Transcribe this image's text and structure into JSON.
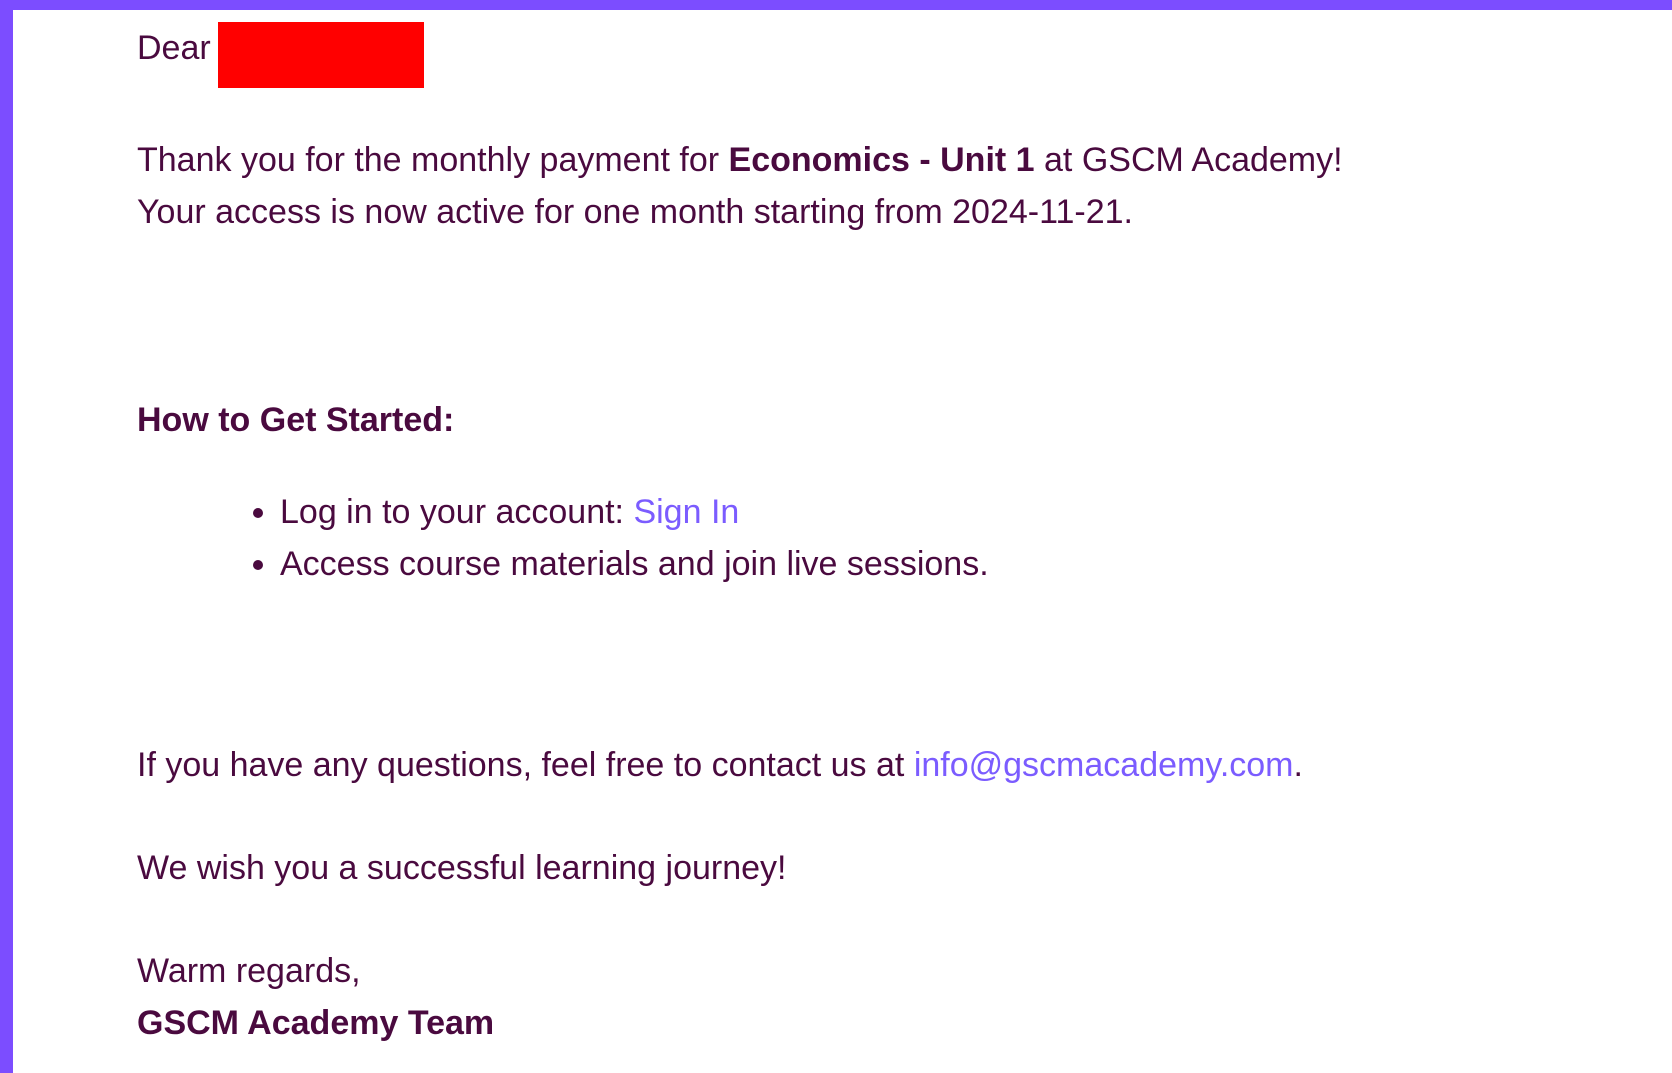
{
  "email": {
    "greeting": {
      "prefix": "Dear",
      "redaction_color": "#ff0000"
    },
    "intro": {
      "line1_before": "Thank you for the monthly payment for ",
      "course": "Economics - Unit 1",
      "line1_after": " at GSCM Academy!",
      "line2": "Your access is now active for one month starting from 2024-11-21."
    },
    "get_started": {
      "heading": "How to Get Started:",
      "steps": [
        {
          "text": "Log in to your account: ",
          "link": "Sign In"
        },
        {
          "text": "Access course materials and join live sessions."
        }
      ]
    },
    "contact": {
      "before": "If you have any questions, feel free to contact us at ",
      "email": "info@gscmacademy.com",
      "after": "."
    },
    "wish": "We wish you a successful learning journey!",
    "closing": {
      "regards": "Warm regards,",
      "signature": "GSCM Academy Team"
    }
  },
  "colors": {
    "frame_border": "#7c4dff",
    "text": "#4a0a3f",
    "link": "#7b5cff",
    "background": "#ffffff"
  }
}
